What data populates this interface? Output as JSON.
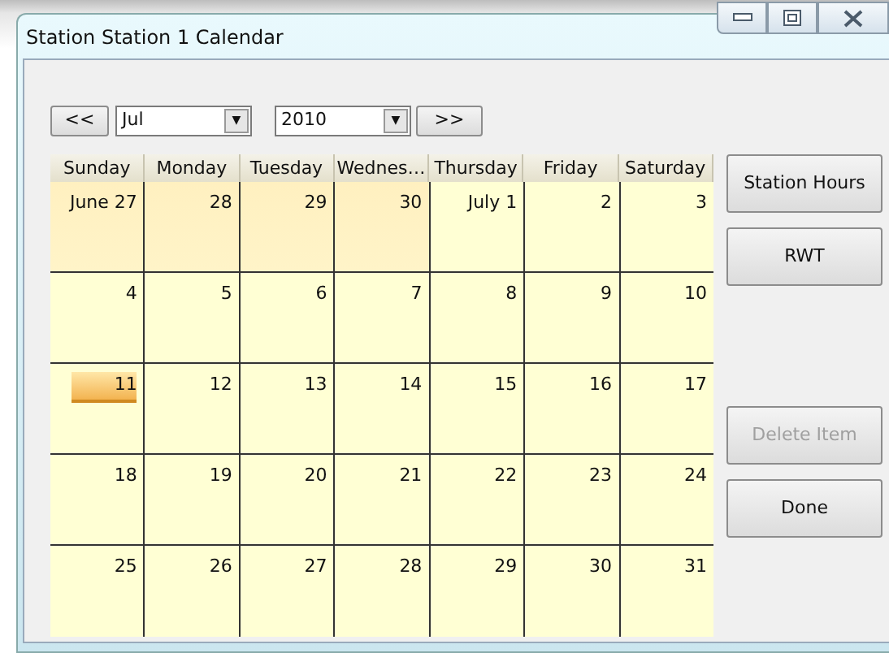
{
  "window": {
    "title": "Station Station 1 Calendar"
  },
  "navigation": {
    "previous": "<<",
    "month": "Jul",
    "year": "2010",
    "next": ">>",
    "dropdown_arrow": "▼"
  },
  "weekdays": [
    "Sunday",
    "Monday",
    "Tuesday",
    "Wednes…",
    "Thursday",
    "Friday",
    "Saturday"
  ],
  "weeks": [
    [
      {
        "label": "June 27",
        "other_month": true,
        "today": false
      },
      {
        "label": "28",
        "other_month": true,
        "today": false
      },
      {
        "label": "29",
        "other_month": true,
        "today": false
      },
      {
        "label": "30",
        "other_month": true,
        "today": false
      },
      {
        "label": "July 1",
        "other_month": false,
        "today": false
      },
      {
        "label": "2",
        "other_month": false,
        "today": false
      },
      {
        "label": "3",
        "other_month": false,
        "today": false
      }
    ],
    [
      {
        "label": "4",
        "other_month": false,
        "today": false
      },
      {
        "label": "5",
        "other_month": false,
        "today": false
      },
      {
        "label": "6",
        "other_month": false,
        "today": false
      },
      {
        "label": "7",
        "other_month": false,
        "today": false
      },
      {
        "label": "8",
        "other_month": false,
        "today": false
      },
      {
        "label": "9",
        "other_month": false,
        "today": false
      },
      {
        "label": "10",
        "other_month": false,
        "today": false
      }
    ],
    [
      {
        "label": "11",
        "other_month": false,
        "today": true
      },
      {
        "label": "12",
        "other_month": false,
        "today": false
      },
      {
        "label": "13",
        "other_month": false,
        "today": false
      },
      {
        "label": "14",
        "other_month": false,
        "today": false
      },
      {
        "label": "15",
        "other_month": false,
        "today": false
      },
      {
        "label": "16",
        "other_month": false,
        "today": false
      },
      {
        "label": "17",
        "other_month": false,
        "today": false
      }
    ],
    [
      {
        "label": "18",
        "other_month": false,
        "today": false
      },
      {
        "label": "19",
        "other_month": false,
        "today": false
      },
      {
        "label": "20",
        "other_month": false,
        "today": false
      },
      {
        "label": "21",
        "other_month": false,
        "today": false
      },
      {
        "label": "22",
        "other_month": false,
        "today": false
      },
      {
        "label": "23",
        "other_month": false,
        "today": false
      },
      {
        "label": "24",
        "other_month": false,
        "today": false
      }
    ],
    [
      {
        "label": "25",
        "other_month": false,
        "today": false
      },
      {
        "label": "26",
        "other_month": false,
        "today": false
      },
      {
        "label": "27",
        "other_month": false,
        "today": false
      },
      {
        "label": "28",
        "other_month": false,
        "today": false
      },
      {
        "label": "29",
        "other_month": false,
        "today": false
      },
      {
        "label": "30",
        "other_month": false,
        "today": false
      },
      {
        "label": "31",
        "other_month": false,
        "today": false
      }
    ]
  ],
  "side_buttons": [
    {
      "label": "Station Hours",
      "disabled": false,
      "gap_before": false
    },
    {
      "label": "RWT",
      "disabled": false,
      "gap_before": false
    },
    {
      "label": "Delete Item",
      "disabled": true,
      "gap_before": true
    },
    {
      "label": "Done",
      "disabled": false,
      "gap_before": false
    }
  ]
}
